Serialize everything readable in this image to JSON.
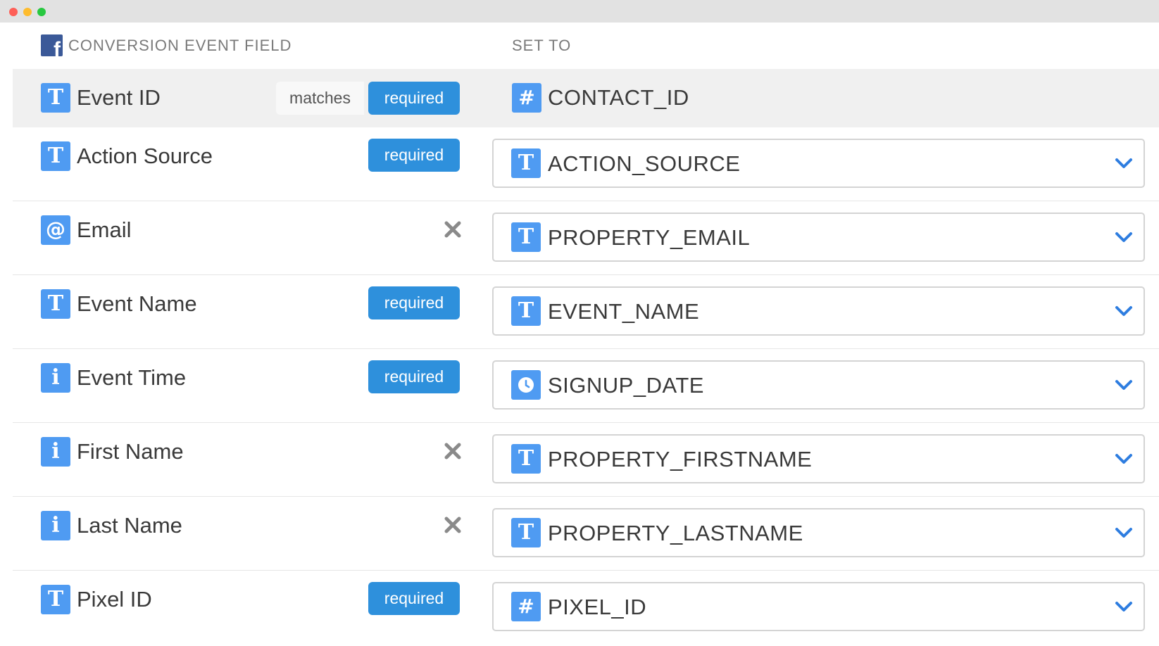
{
  "header": {
    "left_title": "CONVERSION EVENT FIELD",
    "right_title": "SET TO"
  },
  "colors": {
    "accent_blue": "#2e90dc",
    "type_icon_blue": "#4f9bf2",
    "facebook_blue": "#3b5998"
  },
  "rows": [
    {
      "field_icon": "text-type-icon",
      "field_icon_glyph": "T",
      "field_label": "Event ID",
      "matches_label": "matches",
      "badge": "required",
      "value_icon": "number-type-icon",
      "value_icon_glyph": "#",
      "value": "CONTACT_ID"
    },
    {
      "field_icon": "text-type-icon",
      "field_icon_glyph": "T",
      "field_label": "Action Source",
      "badge": "required",
      "value_icon": "text-type-icon",
      "value_icon_glyph": "T",
      "value": "ACTION_SOURCE"
    },
    {
      "field_icon": "email-type-icon",
      "field_icon_glyph": "@",
      "field_label": "Email",
      "value_icon": "text-type-icon",
      "value_icon_glyph": "T",
      "value": "PROPERTY_EMAIL"
    },
    {
      "field_icon": "text-type-icon",
      "field_icon_glyph": "T",
      "field_label": "Event Name",
      "badge": "required",
      "value_icon": "text-type-icon",
      "value_icon_glyph": "T",
      "value": "EVENT_NAME"
    },
    {
      "field_icon": "info-type-icon",
      "field_icon_glyph": "i",
      "field_label": "Event Time",
      "badge": "required",
      "value_icon": "clock-type-icon",
      "value": "SIGNUP_DATE"
    },
    {
      "field_icon": "info-type-icon",
      "field_icon_glyph": "i",
      "field_label": "First Name",
      "value_icon": "text-type-icon",
      "value_icon_glyph": "T",
      "value": "PROPERTY_FIRSTNAME"
    },
    {
      "field_icon": "info-type-icon",
      "field_icon_glyph": "i",
      "field_label": "Last Name",
      "value_icon": "text-type-icon",
      "value_icon_glyph": "T",
      "value": "PROPERTY_LASTNAME"
    },
    {
      "field_icon": "text-type-icon",
      "field_icon_glyph": "T",
      "field_label": "Pixel ID",
      "badge": "required",
      "value_icon": "number-type-icon",
      "value_icon_glyph": "#",
      "value": "PIXEL_ID"
    }
  ]
}
